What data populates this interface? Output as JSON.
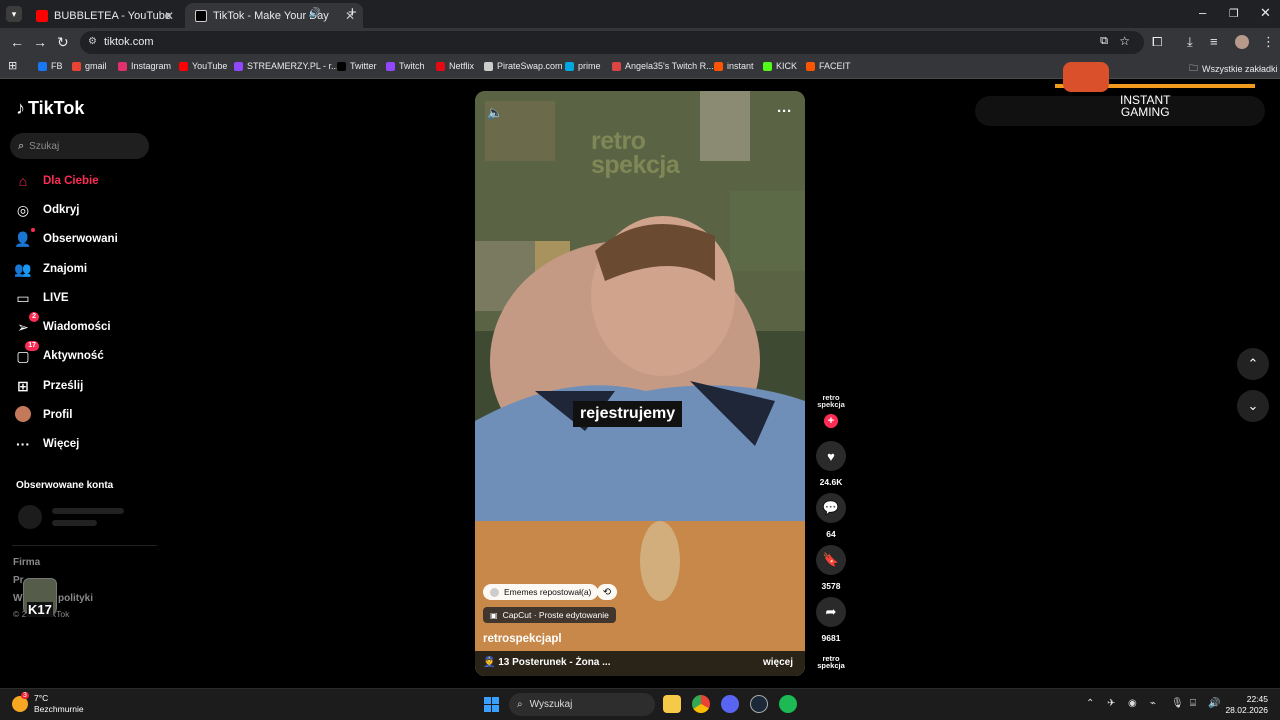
{
  "browser": {
    "tabs": [
      {
        "title": "BUBBLETEA - YouTube",
        "favicon_color": "#ff0000",
        "active": false
      },
      {
        "title": "TikTok - Make Your Day",
        "favicon_color": "#ffffff",
        "active": true
      }
    ],
    "new_tab": "+",
    "url": "tiktok.com",
    "bookmarks": [
      {
        "label": "FB",
        "color": "#1877f2"
      },
      {
        "label": "gmail",
        "color": "#ea4335"
      },
      {
        "label": "Instagram",
        "color": "#e1306c"
      },
      {
        "label": "YouTube",
        "color": "#ff0000"
      },
      {
        "label": "STREAMERZY.PL - r...",
        "color": "#9146ff"
      },
      {
        "label": "Twitter",
        "color": "#000000"
      },
      {
        "label": "Twitch",
        "color": "#9146ff"
      },
      {
        "label": "Netflix",
        "color": "#e50914"
      },
      {
        "label": "PirateSwap.com",
        "color": "#cccccc"
      },
      {
        "label": "prime",
        "color": "#00a8e1"
      },
      {
        "label": "Angela35's Twitch R...",
        "color": "#d44"
      },
      {
        "label": "instant",
        "color": "#ff5400"
      },
      {
        "label": "KICK",
        "color": "#53fc18"
      },
      {
        "label": "FACEIT",
        "color": "#ff5500"
      }
    ],
    "all_bookmarks": "Wszystkie zakładki"
  },
  "sidebar": {
    "logo": "TikTok",
    "search_placeholder": "Szukaj",
    "items": [
      {
        "label": "Dla Ciebie",
        "icon": "home-icon",
        "glyph": "⌂"
      },
      {
        "label": "Odkryj",
        "icon": "compass-icon",
        "glyph": "◎"
      },
      {
        "label": "Obserwowani",
        "icon": "following-icon",
        "glyph": "👤"
      },
      {
        "label": "Znajomi",
        "icon": "friends-icon",
        "glyph": "👥"
      },
      {
        "label": "LIVE",
        "icon": "live-icon",
        "glyph": "▭"
      },
      {
        "label": "Wiadomości",
        "icon": "messages-icon",
        "glyph": "➢",
        "badge": "2"
      },
      {
        "label": "Aktywność",
        "icon": "activity-icon",
        "glyph": "▢",
        "badge": "17"
      },
      {
        "label": "Prześlij",
        "icon": "upload-icon",
        "glyph": "⊞"
      },
      {
        "label": "Profil",
        "icon": "profile-avatar",
        "glyph": "●"
      },
      {
        "label": "Więcej",
        "icon": "more-icon",
        "glyph": "···"
      }
    ],
    "followed_title": "Obserwowane konta",
    "footer": [
      "Firma",
      "Pr",
      "W",
      "polityki",
      "© 2",
      "ikTok"
    ]
  },
  "video": {
    "subtitle": "rejestrujemy",
    "watermark_line1": "retro",
    "watermark_line2": "spekcja",
    "repost_chip": "Ememes repostował(a)",
    "capcut_chip": "CapCut · Proste edytowanie",
    "author": "retrospekcjapl",
    "caption": "13 Posterunek - Żona ...",
    "more": "więcej"
  },
  "actions": {
    "avatar_label": "retro spekcja",
    "likes": "24.6K",
    "comments": "64",
    "saves": "3578",
    "shares": "9681"
  },
  "ad": {
    "line1": "INSTANT",
    "line2": "GAMING"
  },
  "taskbar": {
    "temperature": "7°C",
    "weather_desc": "Bezchmurnie",
    "weather_badge": "3",
    "search_label": "Wyszukaj",
    "time": "22:45",
    "date": "28.02.2026"
  },
  "accent": "#fe2c55"
}
